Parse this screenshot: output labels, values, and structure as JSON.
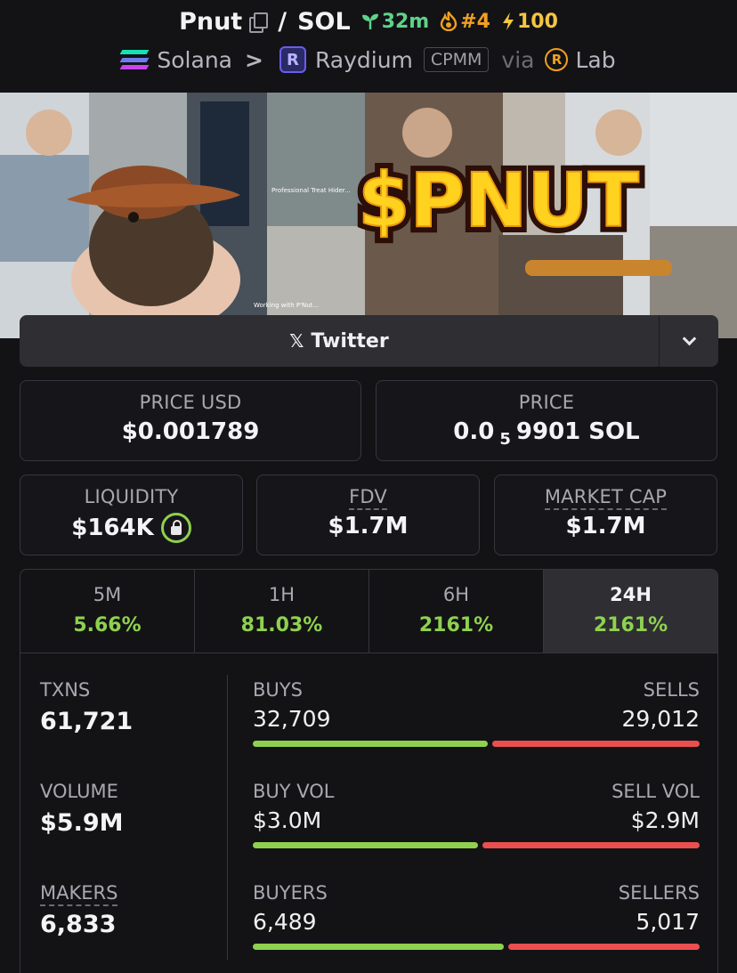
{
  "header": {
    "base": "Pnut",
    "slash": "/",
    "quote": "SOL",
    "age": "32m",
    "rank": "#4",
    "boosts": "100"
  },
  "route": {
    "chain": "Solana",
    "dex": "Raydium",
    "pool_type": "CPMM",
    "via": "via",
    "launchpad": "Lab"
  },
  "banner": {
    "logo_text": "$PNUT",
    "caption_1": "Professional Treat Hider...",
    "caption_2": "Working with P'Nut..."
  },
  "social": {
    "twitter_label": "Twitter"
  },
  "stats": {
    "price_usd_label": "PRICE USD",
    "price_usd": "$0.001789",
    "price_label": "PRICE",
    "price_lead": "0.0",
    "price_zeros": "5",
    "price_tail": "9901 SOL",
    "liquidity_label": "LIQUIDITY",
    "liquidity": "$164K",
    "fdv_label": "FDV",
    "fdv": "$1.7M",
    "mcap_label": "MARKET CAP",
    "mcap": "$1.7M"
  },
  "tabs": [
    {
      "label": "5M",
      "change": "5.66%"
    },
    {
      "label": "1H",
      "change": "81.03%"
    },
    {
      "label": "6H",
      "change": "2161%"
    },
    {
      "label": "24H",
      "change": "2161%"
    }
  ],
  "activity": {
    "txns_label": "TXNS",
    "txns": "61,721",
    "volume_label": "VOLUME",
    "volume": "$5.9M",
    "makers_label": "MAKERS",
    "makers": "6,833",
    "buys_label": "BUYS",
    "buys": "32,709",
    "sells_label": "SELLS",
    "sells": "29,012",
    "buy_vol_label": "BUY VOL",
    "buy_vol": "$3.0M",
    "sell_vol_label": "SELL VOL",
    "sell_vol": "$2.9M",
    "buyers_label": "BUYERS",
    "buyers": "6,489",
    "sellers_label": "SELLERS",
    "sellers": "5,017"
  },
  "colors": {
    "accent_green": "#8fd14f",
    "sell_red": "#ea4f4f",
    "background": "#131316",
    "age_green": "#5fd28a",
    "rank_orange": "#f0a020",
    "boost_yellow": "#f5c542"
  },
  "icons": {
    "copy": "copy-icon",
    "seedling": "seedling-icon",
    "flame": "flame-icon",
    "bolt": "bolt-icon",
    "x_logo": "x-logo-icon",
    "chevron": "chevron-down-icon",
    "lock": "lock-icon"
  }
}
